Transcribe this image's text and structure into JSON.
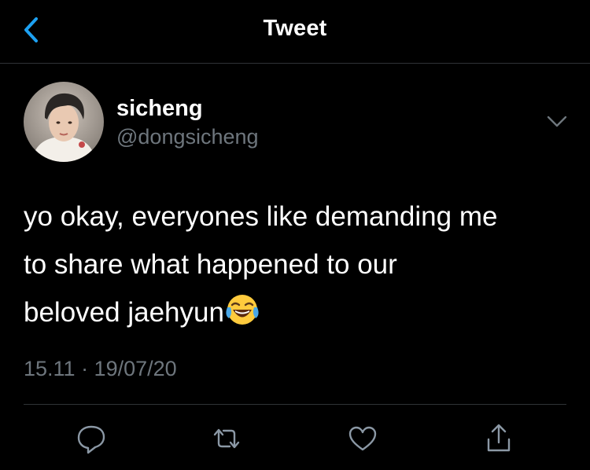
{
  "nav": {
    "title": "Tweet",
    "back_icon": "chevron-left-icon",
    "accent_color": "#1da1f2"
  },
  "author": {
    "display_name": "sicheng",
    "username": "@dongsicheng",
    "avatar_icon": "profile-photo"
  },
  "tweet": {
    "lines": [
      "yo okay, everyones like demanding me",
      "to share what happened to our",
      "beloved jaehyun"
    ],
    "emoji": "face-with-tears-of-joy",
    "timestamp": "15.11 · 19/07/20"
  },
  "actions": [
    {
      "name": "reply",
      "icon": "speech-bubble-icon"
    },
    {
      "name": "retweet",
      "icon": "retweet-icon"
    },
    {
      "name": "like",
      "icon": "heart-icon"
    },
    {
      "name": "share",
      "icon": "share-icon"
    }
  ],
  "colors": {
    "background": "#000000",
    "text": "#ffffff",
    "secondary_text": "#6e767d",
    "icon": "#8b98a5",
    "divider": "#2f3336"
  }
}
